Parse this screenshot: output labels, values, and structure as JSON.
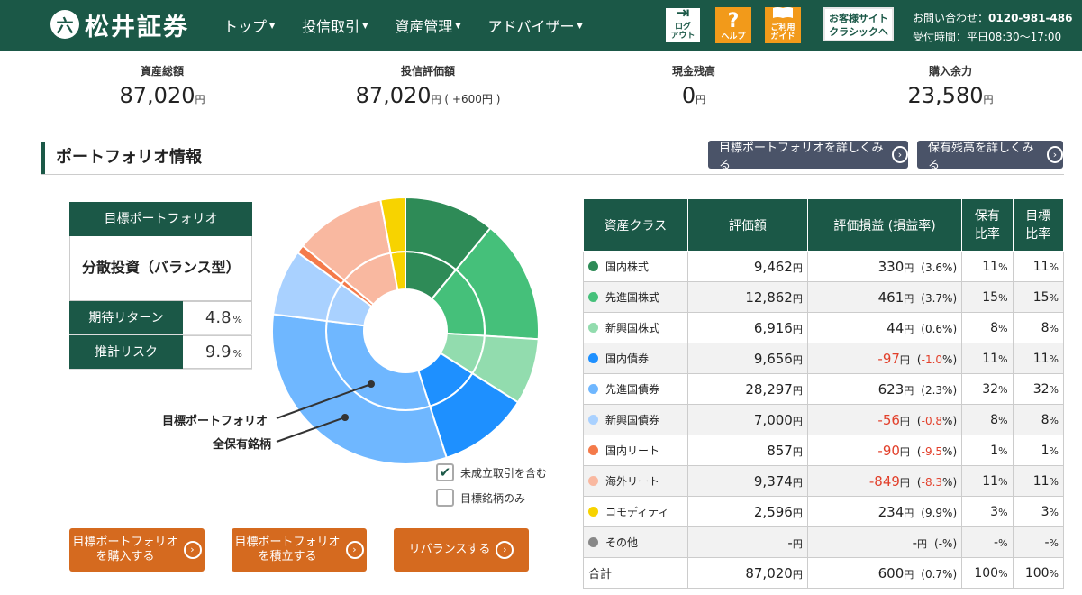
{
  "header": {
    "logo_mark": "六",
    "logo_text": "松井証券",
    "nav": [
      "トップ",
      "投信取引",
      "資産管理",
      "アドバイザー"
    ],
    "logout_glyph": "⇥",
    "logout_label_1": "ログ",
    "logout_label_2": "アウト",
    "help_glyph": "?",
    "help_label": "ヘルプ",
    "guide_label_1": "ご利用",
    "guide_label_2": "ガイド",
    "classic_1": "お客様サイト",
    "classic_2": "クラシックへ",
    "contact_label": "お問い合わせ：",
    "contact_phone": "0120-981-486",
    "hours": "受付時間：平日08:30～17:00"
  },
  "summary": {
    "total_label": "資産総額",
    "total_value": "87,020",
    "unit": "円",
    "fund_label": "投信評価額",
    "fund_value": "87,020",
    "fund_diff_open": "( +600",
    "fund_diff_close": ")",
    "cash_label": "現金残高",
    "cash_value": "0",
    "buying_label": "購入余力",
    "buying_value": "23,580"
  },
  "portfolio": {
    "section_title": "ポートフォリオ情報",
    "btn_target_detail": "目標ポートフォリオを詳しくみる",
    "btn_holdings_detail": "保有残高を詳しくみる",
    "target_head": "目標ポートフォリオ",
    "target_name": "分散投資（バランス型）",
    "return_label": "期待リターン",
    "return_value": "4.8",
    "pct": "%",
    "risk_label": "推計リスク",
    "risk_value": "9.9",
    "label_inner": "目標ポートフォリオ",
    "label_outer": "全保有銘柄",
    "chk_pending": "未成立取引を含む",
    "chk_target_only": "目標銘柄のみ",
    "btn_buy_1": "目標ポートフォリオ",
    "btn_buy_2": "を購入する",
    "btn_accum_1": "目標ポートフォリオ",
    "btn_accum_2": "を積立する",
    "btn_rebalance": "リバランスする"
  },
  "colors": {
    "domestic_stock": "#2e8b57",
    "developed_stock": "#45c07a",
    "emerging_stock": "#92dcae",
    "domestic_bond": "#1e90ff",
    "developed_bond": "#6fb7ff",
    "emerging_bond": "#a9d1ff",
    "domestic_reit": "#f47a4a",
    "foreign_reit": "#f9b8a0",
    "commodity": "#f7d300",
    "other": "#888888"
  },
  "table": {
    "headers": [
      "資産クラス",
      "評価額",
      "評価損益 (損益率)",
      "保有\n比率",
      "目標\n比率"
    ],
    "rows": [
      {
        "name": "国内株式",
        "value": "9,462",
        "pl": "330",
        "rate": "3.6",
        "hold": "11",
        "target": "11"
      },
      {
        "name": "先進国株式",
        "value": "12,862",
        "pl": "461",
        "rate": "3.7",
        "hold": "15",
        "target": "15"
      },
      {
        "name": "新興国株式",
        "value": "6,916",
        "pl": "44",
        "rate": "0.6",
        "hold": "8",
        "target": "8"
      },
      {
        "name": "国内債券",
        "value": "9,656",
        "pl": "-97",
        "rate": "-1.0",
        "hold": "11",
        "target": "11"
      },
      {
        "name": "先進国債券",
        "value": "28,297",
        "pl": "623",
        "rate": "2.3",
        "hold": "32",
        "target": "32"
      },
      {
        "name": "新興国債券",
        "value": "7,000",
        "pl": "-56",
        "rate": "-0.8",
        "hold": "8",
        "target": "8"
      },
      {
        "name": "国内リート",
        "value": "857",
        "pl": "-90",
        "rate": "-9.5",
        "hold": "1",
        "target": "1"
      },
      {
        "name": "海外リート",
        "value": "9,374",
        "pl": "-849",
        "rate": "-8.3",
        "hold": "11",
        "target": "11"
      },
      {
        "name": "コモディティ",
        "value": "2,596",
        "pl": "234",
        "rate": "9.9",
        "hold": "3",
        "target": "3"
      },
      {
        "name": "その他",
        "value": "-",
        "pl": "-",
        "rate": "-",
        "hold": "-",
        "target": "-"
      }
    ],
    "total": {
      "name": "合計",
      "value": "87,020",
      "pl": "600",
      "rate": "0.7",
      "hold": "100",
      "target": "100"
    }
  },
  "chart_data": {
    "type": "pie",
    "categories": [
      "国内株式",
      "先進国株式",
      "新興国株式",
      "国内債券",
      "先進国債券",
      "新興国債券",
      "国内リート",
      "海外リート",
      "コモディティ"
    ],
    "series": [
      {
        "name": "目標ポートフォリオ",
        "values": [
          11,
          15,
          8,
          11,
          32,
          8,
          1,
          11,
          3
        ]
      },
      {
        "name": "全保有銘柄",
        "values": [
          11,
          15,
          8,
          11,
          32,
          8,
          1,
          11,
          3
        ]
      }
    ]
  }
}
